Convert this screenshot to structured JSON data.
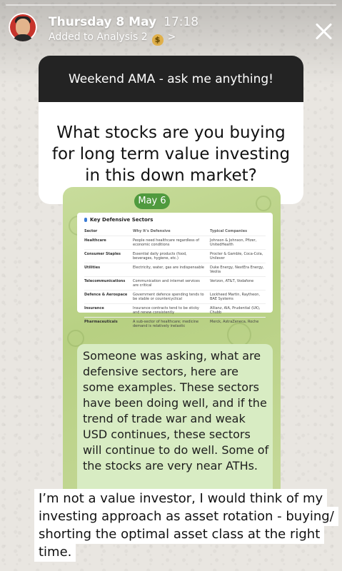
{
  "header": {
    "day": "Thursday 8 May",
    "time": "17:18",
    "subtitle": "Added to Analysis 2",
    "subtitle_emoji": "money-bag-icon",
    "chevron": ">"
  },
  "question_card": {
    "prompt": "Weekend AMA - ask me anything!",
    "question": "What stocks are you buying for long term value investing in this down market?"
  },
  "shared_post": {
    "date": "May 6",
    "table": {
      "title": "Key Defensive Sectors",
      "columns": [
        "Sector",
        "Why It's Defensive",
        "Typical Companies"
      ],
      "rows": [
        [
          "Healthcare",
          "People need healthcare regardless of economic conditions",
          "Johnson & Johnson, Pfizer, UnitedHealth"
        ],
        [
          "Consumer Staples",
          "Essential daily products (food, beverages, hygiene, etc.)",
          "Procter & Gamble, Coca-Cola, Unilever"
        ],
        [
          "Utilities",
          "Electricity, water, gas are indispensable",
          "Duke Energy, NextEra Energy, Veolia"
        ],
        [
          "Telecommunications",
          "Communication and internet services are critical",
          "Verizon, AT&T, Vodafone"
        ],
        [
          "Defence & Aerospace",
          "Government defence spending tends to be stable or countercyclical",
          "Lockheed Martin, Raytheon, BAE Systems"
        ],
        [
          "Insurance",
          "Insurance contracts tend to be sticky and renew consistently",
          "Allianz, AIA, Prudential (UK), Chubb"
        ],
        [
          "Pharmaceuticals",
          "A sub-sector of healthcare; medicine demand is relatively inelastic",
          "Merck, AstraZeneca, Roche"
        ]
      ]
    },
    "message": "Someone was asking, what are defensive sectors, here are some examples. These sectors have been doing well, and if the trend of trade war and weak USD continues, these sectors will continue to do well. Some of the stocks are very near ATHs."
  },
  "caption": "I’m not a value investor, I would think of my investing approach as asset rotation - buying/ shorting the optimal asset class at the right time."
}
